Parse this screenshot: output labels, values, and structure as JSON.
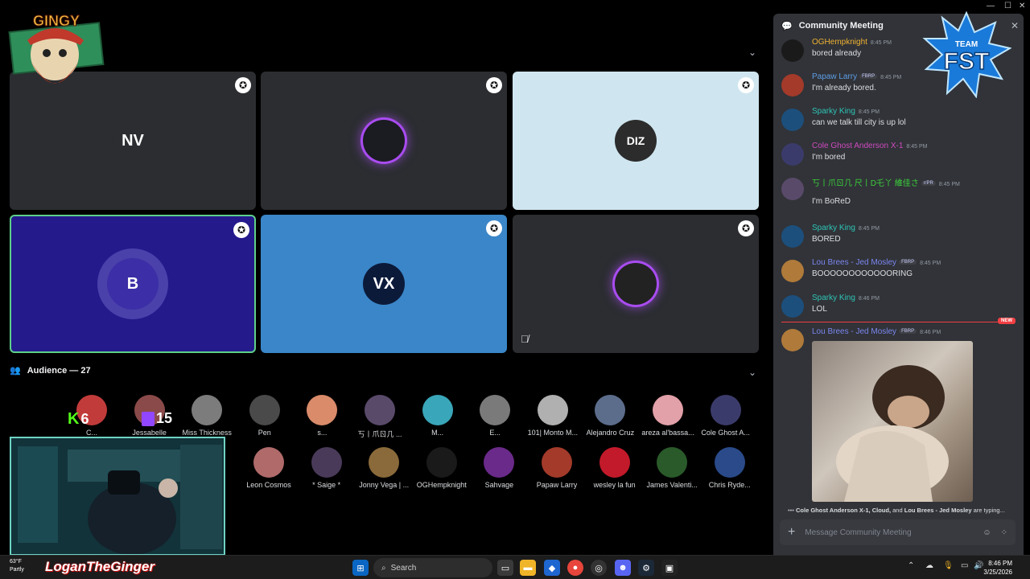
{
  "stage": {
    "tiles": [
      {
        "name": "tile-1",
        "avatar": "NV",
        "bg": "#2b2d31",
        "avatar_bg": "#2b2d31",
        "ring": false
      },
      {
        "name": "tile-2",
        "avatar": "",
        "bg": "#2b2d31",
        "avatar_bg": "#1b1b22",
        "ring": true
      },
      {
        "name": "tile-3",
        "avatar": "DIZ",
        "bg": "#cfe6f0",
        "avatar_bg": "#2c2c2c",
        "ring": false
      },
      {
        "name": "tile-4",
        "avatar": "B",
        "bg": "#241a8c",
        "avatar_bg": "#3b2ea6",
        "ring": false
      },
      {
        "name": "tile-5",
        "avatar": "VX",
        "bg": "#3a86c8",
        "avatar_bg": "#0c1a3a",
        "ring": false
      },
      {
        "name": "tile-6",
        "avatar": "",
        "bg": "#2b2d31",
        "avatar_bg": "#222",
        "ring": true
      }
    ]
  },
  "audience": {
    "title": "Audience — 27",
    "row1": [
      {
        "name": "C...",
        "color": "#c23b3b"
      },
      {
        "name": "Jessabelle",
        "color": "#8b4a4a"
      },
      {
        "name": "Miss Thickness",
        "color": "#7c7c7c"
      },
      {
        "name": "Pen",
        "color": "#4a4a4a"
      },
      {
        "name": "s...",
        "color": "#d98b6a"
      },
      {
        "name": "丂丨爪ㄖ几 ...",
        "color": "#5a4a6a"
      },
      {
        "name": "M...",
        "color": "#3aa6b9"
      },
      {
        "name": "E...",
        "color": "#7a7a7a"
      },
      {
        "name": "101| Monto M...",
        "color": "#b0b0b0"
      },
      {
        "name": "Alejandro Cruz",
        "color": "#5c6d8c"
      },
      {
        "name": "areza al'bassa...",
        "color": "#e2a0a8"
      },
      {
        "name": "Cole Ghost A...",
        "color": "#3b3b6b"
      }
    ],
    "row2": [
      {
        "name": "Leon Cosmos",
        "color": "#b06a6a"
      },
      {
        "name": "* Saige *",
        "color": "#4a3a5a"
      },
      {
        "name": "Jonny Vega | ...",
        "color": "#8a6a3a"
      },
      {
        "name": "OGHempknight",
        "color": "#1a1a1a"
      },
      {
        "name": "Sahvage",
        "color": "#6a2a8a"
      },
      {
        "name": "Papaw Larry",
        "color": "#a33a2a"
      },
      {
        "name": "wesley la fun",
        "color": "#c21a2a"
      },
      {
        "name": "James Valenti...",
        "color": "#2a5a2a"
      },
      {
        "name": "Chris Ryde...",
        "color": "#2a4a8a"
      }
    ]
  },
  "overlay": {
    "logo_text": "GINGY",
    "kick_count": "6",
    "twitch_count": "15",
    "fst_text": "FST",
    "fst_sub": "TEAM"
  },
  "chat": {
    "title": "Community Meeting",
    "messages": [
      {
        "name": "OGHempknight",
        "time": "8:45 PM",
        "text": "bored already",
        "color": "#f0b232",
        "badge": "",
        "pic": "#1a1a1a"
      },
      {
        "name": "Papaw Larry",
        "time": "8:45 PM",
        "text": "I'm already bored.",
        "color": "#5d9ee6",
        "badge": "FBRP",
        "pic": "#a33a2a"
      },
      {
        "name": "Sparky King",
        "time": "8:45 PM",
        "text": "can we talk till city is up lol",
        "color": "#2ec4b6",
        "badge": "",
        "pic": "#1c4f7c"
      },
      {
        "name": "Cole Ghost Anderson X-1",
        "time": "8:45 PM",
        "text": "I'm bored",
        "color": "#d04ac0",
        "badge": "",
        "pic": "#3b3b6b"
      },
      {
        "name": "丂丨爪ㄖ几 尺丨D乇丫 維佳さ",
        "time": "8:45 PM",
        "text": "I'm BoReD",
        "color": "#3bd13b",
        "badge": "r/PR",
        "pic": "#5a4a6a"
      },
      {
        "name": "Sparky King",
        "time": "8:45 PM",
        "text": "BORED",
        "color": "#2ec4b6",
        "badge": "",
        "pic": "#1c4f7c"
      },
      {
        "name": "Lou Brees - Jed Mosley",
        "time": "8:45 PM",
        "text": "BOOOOOOOOOOOORING",
        "color": "#7b86f0",
        "badge": "FBRP",
        "pic": "#b07a3a"
      },
      {
        "name": "Sparky King",
        "time": "8:46 PM",
        "text": "LOL",
        "color": "#2ec4b6",
        "badge": "",
        "pic": "#1c4f7c"
      },
      {
        "name": "Lou Brees - Jed Mosley",
        "time": "8:46 PM",
        "text": "",
        "color": "#7b86f0",
        "badge": "FBRP",
        "pic": "#b07a3a"
      }
    ],
    "new_label": "NEW",
    "typing_names": "Cole Ghost Anderson X-1, Cloud,",
    "typing_and": " and ",
    "typing_last": "Lou Brees - Jed Mosley",
    "typing_suffix": " are typing...",
    "composer_placeholder": "Message Community Meeting"
  },
  "taskbar": {
    "weather_temp": "63°F",
    "weather_desc": "Partly",
    "streamer": "LoganTheGinger",
    "search_placeholder": "Search",
    "time": "8:46 PM",
    "date": "3/25/2026"
  }
}
